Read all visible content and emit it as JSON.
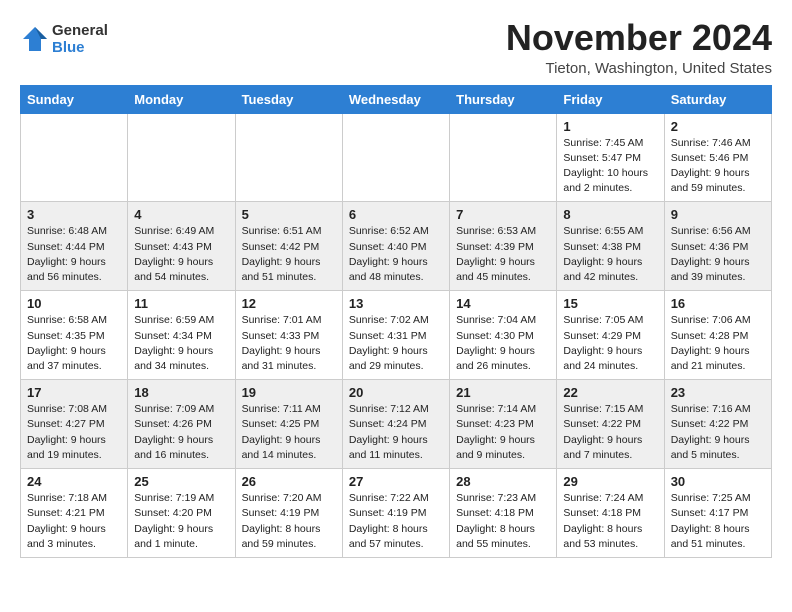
{
  "header": {
    "logo_line1": "General",
    "logo_line2": "Blue",
    "month": "November 2024",
    "location": "Tieton, Washington, United States"
  },
  "weekdays": [
    "Sunday",
    "Monday",
    "Tuesday",
    "Wednesday",
    "Thursday",
    "Friday",
    "Saturday"
  ],
  "weeks": [
    [
      {
        "day": "",
        "info": ""
      },
      {
        "day": "",
        "info": ""
      },
      {
        "day": "",
        "info": ""
      },
      {
        "day": "",
        "info": ""
      },
      {
        "day": "",
        "info": ""
      },
      {
        "day": "1",
        "info": "Sunrise: 7:45 AM\nSunset: 5:47 PM\nDaylight: 10 hours\nand 2 minutes."
      },
      {
        "day": "2",
        "info": "Sunrise: 7:46 AM\nSunset: 5:46 PM\nDaylight: 9 hours\nand 59 minutes."
      }
    ],
    [
      {
        "day": "3",
        "info": "Sunrise: 6:48 AM\nSunset: 4:44 PM\nDaylight: 9 hours\nand 56 minutes."
      },
      {
        "day": "4",
        "info": "Sunrise: 6:49 AM\nSunset: 4:43 PM\nDaylight: 9 hours\nand 54 minutes."
      },
      {
        "day": "5",
        "info": "Sunrise: 6:51 AM\nSunset: 4:42 PM\nDaylight: 9 hours\nand 51 minutes."
      },
      {
        "day": "6",
        "info": "Sunrise: 6:52 AM\nSunset: 4:40 PM\nDaylight: 9 hours\nand 48 minutes."
      },
      {
        "day": "7",
        "info": "Sunrise: 6:53 AM\nSunset: 4:39 PM\nDaylight: 9 hours\nand 45 minutes."
      },
      {
        "day": "8",
        "info": "Sunrise: 6:55 AM\nSunset: 4:38 PM\nDaylight: 9 hours\nand 42 minutes."
      },
      {
        "day": "9",
        "info": "Sunrise: 6:56 AM\nSunset: 4:36 PM\nDaylight: 9 hours\nand 39 minutes."
      }
    ],
    [
      {
        "day": "10",
        "info": "Sunrise: 6:58 AM\nSunset: 4:35 PM\nDaylight: 9 hours\nand 37 minutes."
      },
      {
        "day": "11",
        "info": "Sunrise: 6:59 AM\nSunset: 4:34 PM\nDaylight: 9 hours\nand 34 minutes."
      },
      {
        "day": "12",
        "info": "Sunrise: 7:01 AM\nSunset: 4:33 PM\nDaylight: 9 hours\nand 31 minutes."
      },
      {
        "day": "13",
        "info": "Sunrise: 7:02 AM\nSunset: 4:31 PM\nDaylight: 9 hours\nand 29 minutes."
      },
      {
        "day": "14",
        "info": "Sunrise: 7:04 AM\nSunset: 4:30 PM\nDaylight: 9 hours\nand 26 minutes."
      },
      {
        "day": "15",
        "info": "Sunrise: 7:05 AM\nSunset: 4:29 PM\nDaylight: 9 hours\nand 24 minutes."
      },
      {
        "day": "16",
        "info": "Sunrise: 7:06 AM\nSunset: 4:28 PM\nDaylight: 9 hours\nand 21 minutes."
      }
    ],
    [
      {
        "day": "17",
        "info": "Sunrise: 7:08 AM\nSunset: 4:27 PM\nDaylight: 9 hours\nand 19 minutes."
      },
      {
        "day": "18",
        "info": "Sunrise: 7:09 AM\nSunset: 4:26 PM\nDaylight: 9 hours\nand 16 minutes."
      },
      {
        "day": "19",
        "info": "Sunrise: 7:11 AM\nSunset: 4:25 PM\nDaylight: 9 hours\nand 14 minutes."
      },
      {
        "day": "20",
        "info": "Sunrise: 7:12 AM\nSunset: 4:24 PM\nDaylight: 9 hours\nand 11 minutes."
      },
      {
        "day": "21",
        "info": "Sunrise: 7:14 AM\nSunset: 4:23 PM\nDaylight: 9 hours\nand 9 minutes."
      },
      {
        "day": "22",
        "info": "Sunrise: 7:15 AM\nSunset: 4:22 PM\nDaylight: 9 hours\nand 7 minutes."
      },
      {
        "day": "23",
        "info": "Sunrise: 7:16 AM\nSunset: 4:22 PM\nDaylight: 9 hours\nand 5 minutes."
      }
    ],
    [
      {
        "day": "24",
        "info": "Sunrise: 7:18 AM\nSunset: 4:21 PM\nDaylight: 9 hours\nand 3 minutes."
      },
      {
        "day": "25",
        "info": "Sunrise: 7:19 AM\nSunset: 4:20 PM\nDaylight: 9 hours\nand 1 minute."
      },
      {
        "day": "26",
        "info": "Sunrise: 7:20 AM\nSunset: 4:19 PM\nDaylight: 8 hours\nand 59 minutes."
      },
      {
        "day": "27",
        "info": "Sunrise: 7:22 AM\nSunset: 4:19 PM\nDaylight: 8 hours\nand 57 minutes."
      },
      {
        "day": "28",
        "info": "Sunrise: 7:23 AM\nSunset: 4:18 PM\nDaylight: 8 hours\nand 55 minutes."
      },
      {
        "day": "29",
        "info": "Sunrise: 7:24 AM\nSunset: 4:18 PM\nDaylight: 8 hours\nand 53 minutes."
      },
      {
        "day": "30",
        "info": "Sunrise: 7:25 AM\nSunset: 4:17 PM\nDaylight: 8 hours\nand 51 minutes."
      }
    ]
  ]
}
